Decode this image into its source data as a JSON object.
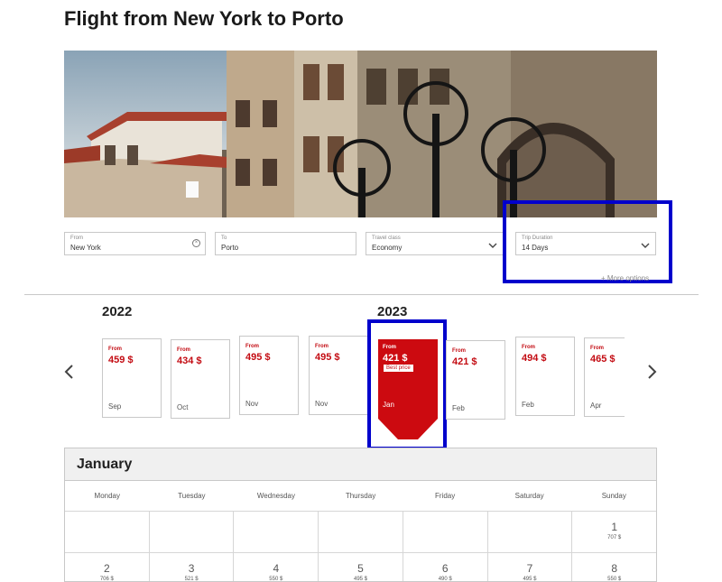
{
  "page": {
    "title": "Flight from New York to Porto"
  },
  "search": {
    "from": {
      "label": "From",
      "value": "New York"
    },
    "to": {
      "label": "To",
      "value": "Porto"
    },
    "travel_class": {
      "label": "Travel class",
      "value": "Economy"
    },
    "trip_duration": {
      "label": "Trip Duration",
      "value": "14 Days"
    },
    "more_options": "+ More options"
  },
  "years": [
    "2022",
    "2023"
  ],
  "months": [
    {
      "from": "From",
      "price": "459 $",
      "month": "Sep"
    },
    {
      "from": "From",
      "price": "434 $",
      "month": "Oct"
    },
    {
      "from": "From",
      "price": "495 $",
      "month": "Nov"
    },
    {
      "from": "From",
      "price": "495 $",
      "month": "Nov"
    },
    {
      "from": "From",
      "price": "421 $",
      "month": "Jan",
      "badge": "Best price"
    },
    {
      "from": "From",
      "price": "421 $",
      "month": "Feb"
    },
    {
      "from": "From",
      "price": "494 $",
      "month": "Feb"
    },
    {
      "from": "From",
      "price": "465 $",
      "month": "Apr"
    }
  ],
  "calendar": {
    "month": "January",
    "weekdays": [
      "Monday",
      "Tuesday",
      "Wednesday",
      "Thursday",
      "Friday",
      "Saturday",
      "Sunday"
    ],
    "week1": [
      {
        "day": "",
        "price": ""
      },
      {
        "day": "",
        "price": ""
      },
      {
        "day": "",
        "price": ""
      },
      {
        "day": "",
        "price": ""
      },
      {
        "day": "",
        "price": ""
      },
      {
        "day": "",
        "price": ""
      },
      {
        "day": "1",
        "price": "707 $"
      }
    ],
    "week2": [
      {
        "day": "2",
        "price": "706 $"
      },
      {
        "day": "3",
        "price": "521 $"
      },
      {
        "day": "4",
        "price": "550 $"
      },
      {
        "day": "5",
        "price": "495 $"
      },
      {
        "day": "6",
        "price": "490 $"
      },
      {
        "day": "7",
        "price": "495 $"
      },
      {
        "day": "8",
        "price": "550 $"
      }
    ]
  },
  "colors": {
    "accent": "#c30b12",
    "highlight": "#0000cc"
  },
  "icons": {
    "prev": "chevron-left-icon",
    "next": "chevron-right-icon",
    "clear": "clear-icon",
    "dropdown": "chevron-down-icon"
  }
}
